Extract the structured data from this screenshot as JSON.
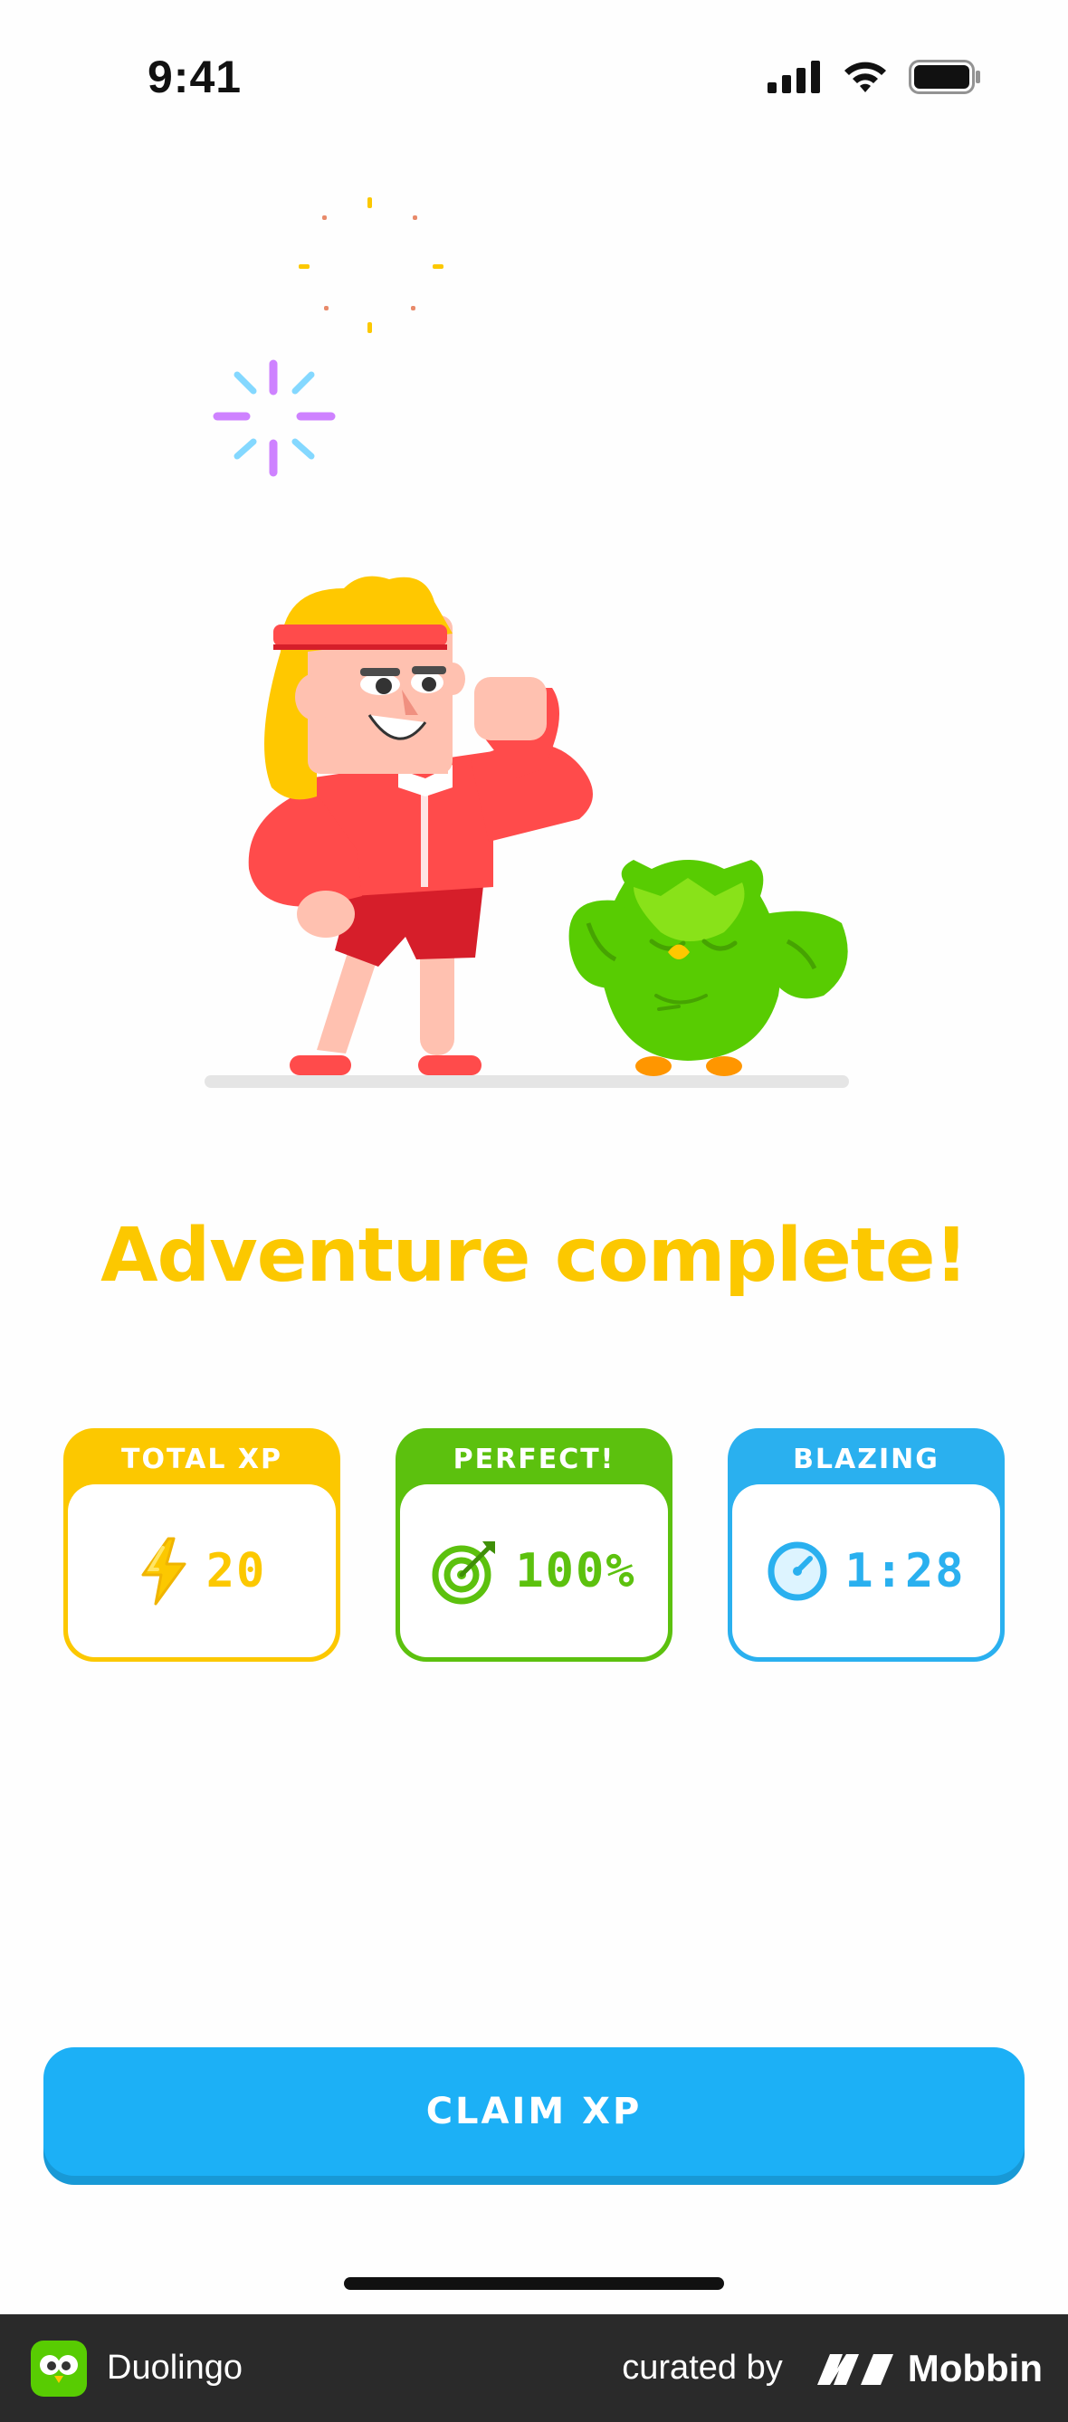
{
  "status_bar": {
    "time": "9:41"
  },
  "main": {
    "headline": "Adventure complete!"
  },
  "stats": [
    {
      "label": "TOTAL XP",
      "value": "20",
      "icon": "lightning-icon",
      "color": "#fcc800"
    },
    {
      "label": "PERFECT!",
      "value": "100%",
      "icon": "target-icon",
      "color": "#5cc10e"
    },
    {
      "label": "BLAZING",
      "value": "1:28",
      "icon": "stopwatch-icon",
      "color": "#2ab0ef"
    }
  ],
  "actions": {
    "claim_label": "CLAIM XP",
    "claim_color": "#1cb0f6"
  },
  "footer": {
    "app_name": "Duolingo",
    "curated_by": "curated by",
    "brand_name": "Mobbin"
  }
}
